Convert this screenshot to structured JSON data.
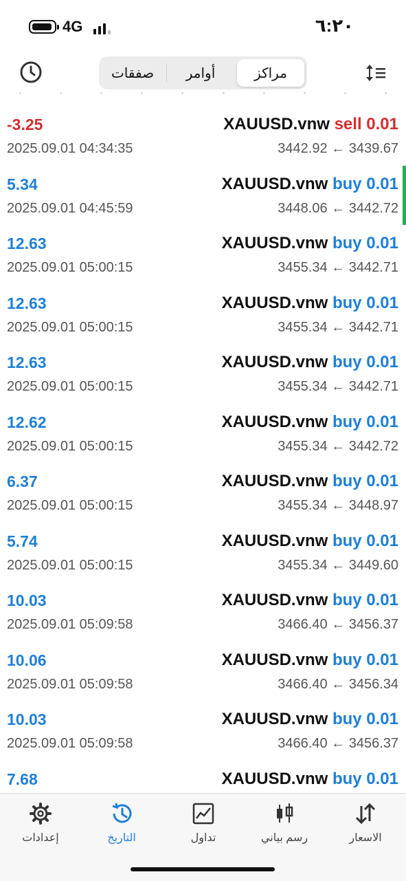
{
  "status": {
    "network": "4G",
    "time": "٦:٢٠"
  },
  "tabs": {
    "positions": "مراكز",
    "orders": "أوامر",
    "deals": "صفقات",
    "active": "positions"
  },
  "trades": [
    {
      "symbol": "XAUUSD.vnw",
      "side": "sell",
      "volume": "0.01",
      "profit": "-3.25",
      "time": "2025.09.01 04:34:35",
      "open_price": "3439.67",
      "close_price": "3442.92"
    },
    {
      "symbol": "XAUUSD.vnw",
      "side": "buy",
      "volume": "0.01",
      "profit": "5.34",
      "time": "2025.09.01 04:45:59",
      "open_price": "3442.72",
      "close_price": "3448.06"
    },
    {
      "symbol": "XAUUSD.vnw",
      "side": "buy",
      "volume": "0.01",
      "profit": "12.63",
      "time": "2025.09.01 05:00:15",
      "open_price": "3442.71",
      "close_price": "3455.34"
    },
    {
      "symbol": "XAUUSD.vnw",
      "side": "buy",
      "volume": "0.01",
      "profit": "12.63",
      "time": "2025.09.01 05:00:15",
      "open_price": "3442.71",
      "close_price": "3455.34"
    },
    {
      "symbol": "XAUUSD.vnw",
      "side": "buy",
      "volume": "0.01",
      "profit": "12.63",
      "time": "2025.09.01 05:00:15",
      "open_price": "3442.71",
      "close_price": "3455.34"
    },
    {
      "symbol": "XAUUSD.vnw",
      "side": "buy",
      "volume": "0.01",
      "profit": "12.62",
      "time": "2025.09.01 05:00:15",
      "open_price": "3442.72",
      "close_price": "3455.34"
    },
    {
      "symbol": "XAUUSD.vnw",
      "side": "buy",
      "volume": "0.01",
      "profit": "6.37",
      "time": "2025.09.01 05:00:15",
      "open_price": "3448.97",
      "close_price": "3455.34"
    },
    {
      "symbol": "XAUUSD.vnw",
      "side": "buy",
      "volume": "0.01",
      "profit": "5.74",
      "time": "2025.09.01 05:00:15",
      "open_price": "3449.60",
      "close_price": "3455.34"
    },
    {
      "symbol": "XAUUSD.vnw",
      "side": "buy",
      "volume": "0.01",
      "profit": "10.03",
      "time": "2025.09.01 05:09:58",
      "open_price": "3456.37",
      "close_price": "3466.40"
    },
    {
      "symbol": "XAUUSD.vnw",
      "side": "buy",
      "volume": "0.01",
      "profit": "10.06",
      "time": "2025.09.01 05:09:58",
      "open_price": "3456.34",
      "close_price": "3466.40"
    },
    {
      "symbol": "XAUUSD.vnw",
      "side": "buy",
      "volume": "0.01",
      "profit": "10.03",
      "time": "2025.09.01 05:09:58",
      "open_price": "3456.37",
      "close_price": "3466.40"
    },
    {
      "symbol": "XAUUSD.vnw",
      "side": "buy",
      "volume": "0.01",
      "profit": "7.68",
      "time": "",
      "open_price": "",
      "close_price": ""
    }
  ],
  "arrow": "←",
  "bottom_tabs": {
    "quotes": "الاسعار",
    "chart": "رسم بياني",
    "trade": "تداول",
    "history": "التاريخ",
    "settings": "إعدادات",
    "active": "history"
  },
  "colors": {
    "profit_positive": "#1f7fd6",
    "profit_negative": "#d22f2f",
    "buy": "#1f7fd6",
    "sell": "#d22f2f",
    "accent": "#1f7fd6",
    "indicator": "#22b14c"
  },
  "icons": {
    "toolbar_left": "history-clock-icon",
    "toolbar_right": "sort-icon",
    "quotes": "arrows-up-down-icon",
    "chart": "candlestick-icon",
    "trade": "line-chart-icon",
    "history": "history-clock-icon",
    "settings": "gear-icon"
  }
}
